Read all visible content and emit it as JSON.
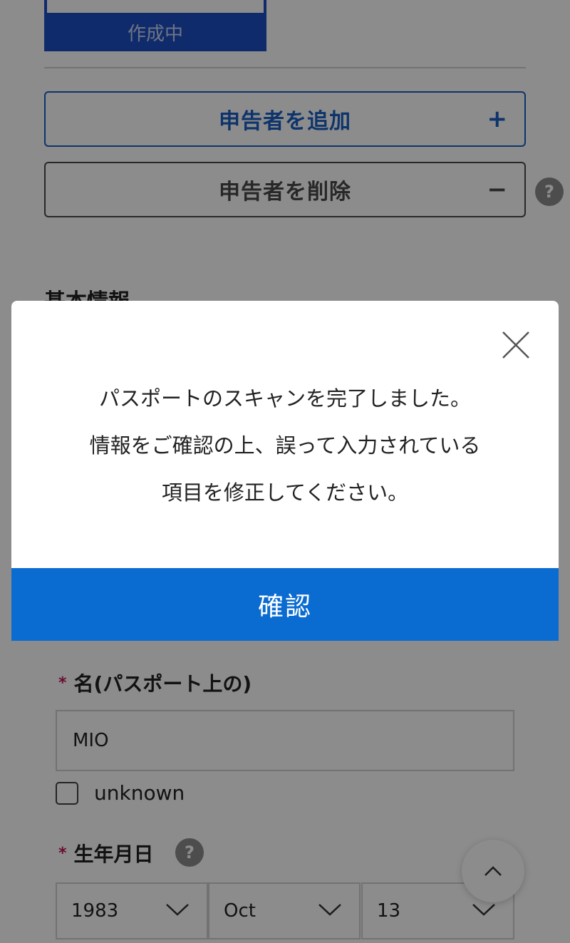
{
  "tab": {
    "label": "作成中"
  },
  "actions": {
    "add_label": "申告者を追加",
    "add_symbol": "+",
    "delete_label": "申告者を削除",
    "delete_symbol": "−"
  },
  "help": {
    "symbol": "?"
  },
  "section": {
    "title": "基本情報"
  },
  "fields": {
    "given_name": {
      "required_mark": "*",
      "label": "名(パスポート上の)",
      "value": "MIO"
    },
    "unknown": {
      "label": "unknown"
    },
    "birth_date": {
      "required_mark": "*",
      "label": "生年月日",
      "year": "1983",
      "month": "Oct",
      "day": "13"
    }
  },
  "modal": {
    "lines": [
      "パスポートのスキャンを完了しました。",
      "情報をご確認の上、誤って入力されている",
      "項目を修正してください。"
    ],
    "confirm_label": "確認"
  },
  "colors": {
    "primary": "#0a6bd1",
    "tab": "#1e4fc4",
    "required": "#c2185b"
  },
  "icons": {
    "close": "close-icon",
    "chevron": "chevron-down-icon",
    "scroll_top": "chevron-up-icon"
  }
}
